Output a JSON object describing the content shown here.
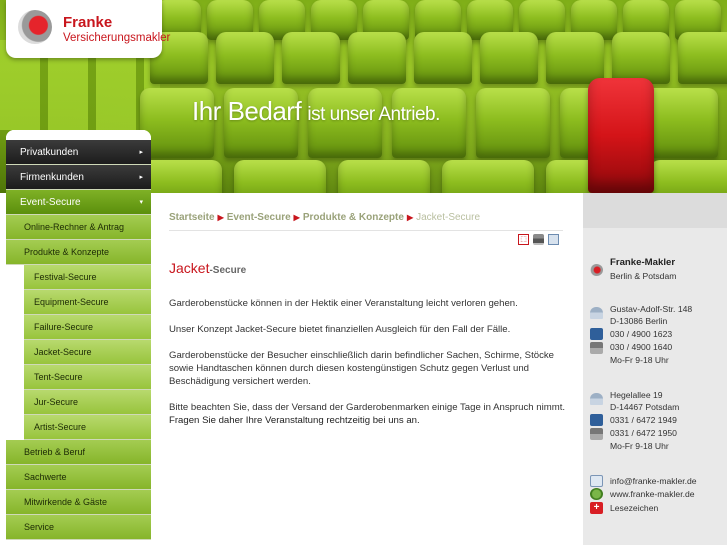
{
  "logo": {
    "name": "Franke",
    "sub": "Versicherungsmakler"
  },
  "banner": {
    "slogan_a": "Ihr Bedarf",
    "slogan_b": "ist unser Antrieb."
  },
  "sidebar": {
    "items": [
      {
        "label": "Privatkunden",
        "level": 0,
        "arrow": "▸"
      },
      {
        "label": "Firmenkunden",
        "level": 0,
        "arrow": "▸"
      },
      {
        "label": "Event-Secure",
        "level": 0,
        "arrow": "▾"
      },
      {
        "label": "Online-Rechner & Antrag",
        "level": 1
      },
      {
        "label": "Produkte & Konzepte",
        "level": 1
      },
      {
        "label": "Festival-Secure",
        "level": 2
      },
      {
        "label": "Equipment-Secure",
        "level": 2
      },
      {
        "label": "Failure-Secure",
        "level": 2
      },
      {
        "label": "Jacket-Secure",
        "level": 2
      },
      {
        "label": "Tent-Secure",
        "level": 2
      },
      {
        "label": "Jur-Secure",
        "level": 2
      },
      {
        "label": "Artist-Secure",
        "level": 2
      },
      {
        "label": "Betrieb & Beruf",
        "level": 1
      },
      {
        "label": "Sachwerte",
        "level": 1
      },
      {
        "label": "Mitwirkende & Gäste",
        "level": 1
      },
      {
        "label": "Service",
        "level": 1
      }
    ]
  },
  "breadcrumb": {
    "items": [
      "Startseite",
      "Event-Secure",
      "Produkte & Konzepte"
    ],
    "current": "Jacket-Secure",
    "separator": "▶"
  },
  "tools": {
    "pdf": "pdf-icon",
    "print": "print-icon",
    "mail": "mail-icon"
  },
  "page": {
    "title": "Jacket",
    "title_suffix": "-Secure",
    "paragraphs": [
      "Garderobenstücke können in der Hektik einer Veranstaltung leicht verloren gehen.",
      "Unser Konzept Jacket-Secure bietet finanziellen Ausgleich für den Fall der Fälle.",
      "Garderobenstücke der Besucher einschließlich darin befindlicher Sachen, Schirme, Stöcke sowie Handtaschen können durch diesen kostengünstigen Schutz gegen Verlust und Beschädigung versichert werden.",
      "Bitte beachten Sie, dass der Versand der Garderobenmarken einige Tage in Anspruch nimmt."
    ],
    "emphasis": "Fragen Sie daher Ihre Veranstaltung rechtzeitig bei uns an."
  },
  "contact": {
    "name": "Franke-Makler",
    "cities": "Berlin & Potsdam",
    "berlin": {
      "street": "Gustav-Adolf-Str. 148",
      "city": "D-13086 Berlin",
      "phone": "030 / 4900 1623",
      "fax": "030 / 4900 1640",
      "hours": "Mo-Fr 9-18 Uhr"
    },
    "potsdam": {
      "street": "Hegelallee 19",
      "city": "D-14467 Potsdam",
      "phone": "0331 / 6472 1949",
      "fax": "0331 / 6472 1950",
      "hours": "Mo-Fr 9-18 Uhr"
    },
    "email": "info@franke-makler.de",
    "web": "www.franke-makler.de",
    "bookmark": "Lesezeichen"
  },
  "colors": {
    "brand_red": "#c8161d",
    "nav_green": "#7fb126",
    "banner_green": "#96c224"
  }
}
